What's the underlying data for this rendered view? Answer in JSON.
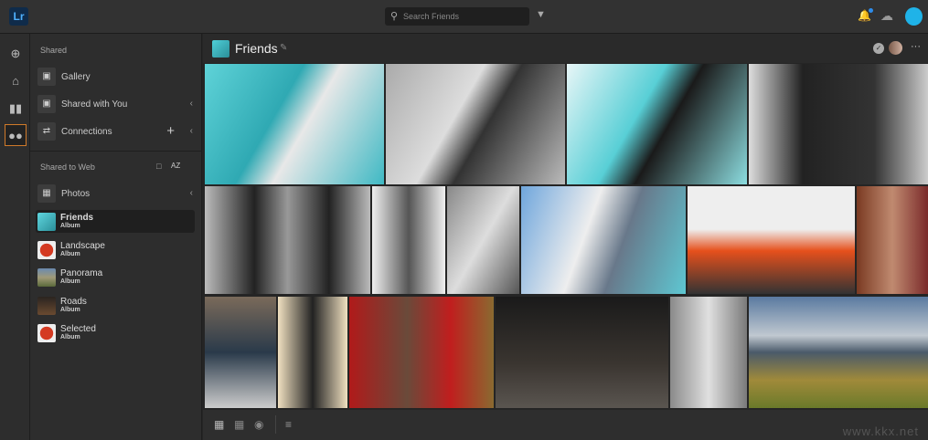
{
  "app": {
    "logo": "Lr"
  },
  "topbar": {
    "search_placeholder": "Search Friends",
    "icons": [
      "search-icon",
      "filter-icon",
      "bell-icon",
      "cloud-icon",
      "user-avatar"
    ]
  },
  "rail": {
    "icons": [
      "add-icon",
      "home-icon",
      "library-icon",
      "shared-icon"
    ],
    "active": "shared-icon"
  },
  "panel": {
    "shared_heading": "Shared",
    "items": [
      {
        "label": "Gallery",
        "icon": "gallery-icon"
      },
      {
        "label": "Shared with You",
        "icon": "inbox-icon"
      },
      {
        "label": "Connections",
        "icon": "connections-icon"
      }
    ],
    "web_heading": "Shared to Web",
    "photos_label": "Photos",
    "albums": [
      {
        "name": "Friends",
        "type": "Album",
        "selected": true,
        "color": "#3fb9c4"
      },
      {
        "name": "Landscape",
        "type": "Album",
        "color": "#c0301e"
      },
      {
        "name": "Panorama",
        "type": "Album",
        "color": "#8a8a6a"
      },
      {
        "name": "Roads",
        "type": "Album",
        "color": "#4a3a2a"
      },
      {
        "name": "Selected",
        "type": "Album",
        "color": "#c0301e"
      }
    ]
  },
  "header": {
    "title": "Friends"
  },
  "colors": {
    "accent": "#d07a2a",
    "brand": "#4fb1ff",
    "avatar": "#1fb3e8"
  },
  "watermark": "www.kkx.net"
}
